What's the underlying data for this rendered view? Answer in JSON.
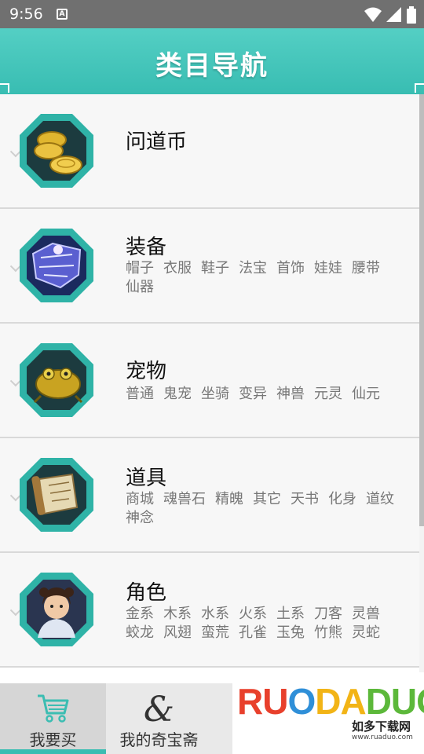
{
  "status_bar": {
    "time": "9:56",
    "notif_letter": "A"
  },
  "header": {
    "title": "类目导航"
  },
  "categories": [
    {
      "title": "问道币",
      "subs": [],
      "icon": "coins-icon"
    },
    {
      "title": "装备",
      "subs": [
        "帽子",
        "衣服",
        "鞋子",
        "法宝",
        "首饰",
        "娃娃",
        "腰带",
        "仙器"
      ],
      "icon": "armor-icon"
    },
    {
      "title": "宠物",
      "subs": [
        "普通",
        "鬼宠",
        "坐骑",
        "变异",
        "神兽",
        "元灵",
        "仙元"
      ],
      "icon": "pet-icon"
    },
    {
      "title": "道具",
      "subs": [
        "商城",
        "魂兽石",
        "精魄",
        "其它",
        "天书",
        "化身",
        "道纹",
        "神念"
      ],
      "icon": "scroll-icon"
    },
    {
      "title": "角色",
      "subs": [
        "金系",
        "木系",
        "水系",
        "火系",
        "土系",
        "刀客",
        "灵兽",
        "蛟龙",
        "风翅",
        "蛮荒",
        "孔雀",
        "玉兔",
        "竹熊",
        "灵蛇"
      ],
      "icon": "character-icon"
    }
  ],
  "bottom_nav": {
    "buy_label": "我要买",
    "treasure_label": "我的奇宝斋",
    "active_tab": "buy"
  },
  "watermark": {
    "logo_text_1": "RU",
    "logo_text_2": "O",
    "logo_text_3": "DA",
    "logo_text_4": "DUO",
    "slogan": "如多下载网",
    "url": "www.ruaduo.com"
  },
  "colors": {
    "accent": "#3bbdb2",
    "header": "#46c6bb",
    "icon_frame": "#2fb3a7",
    "icon_bg": "#1c3b3f"
  }
}
